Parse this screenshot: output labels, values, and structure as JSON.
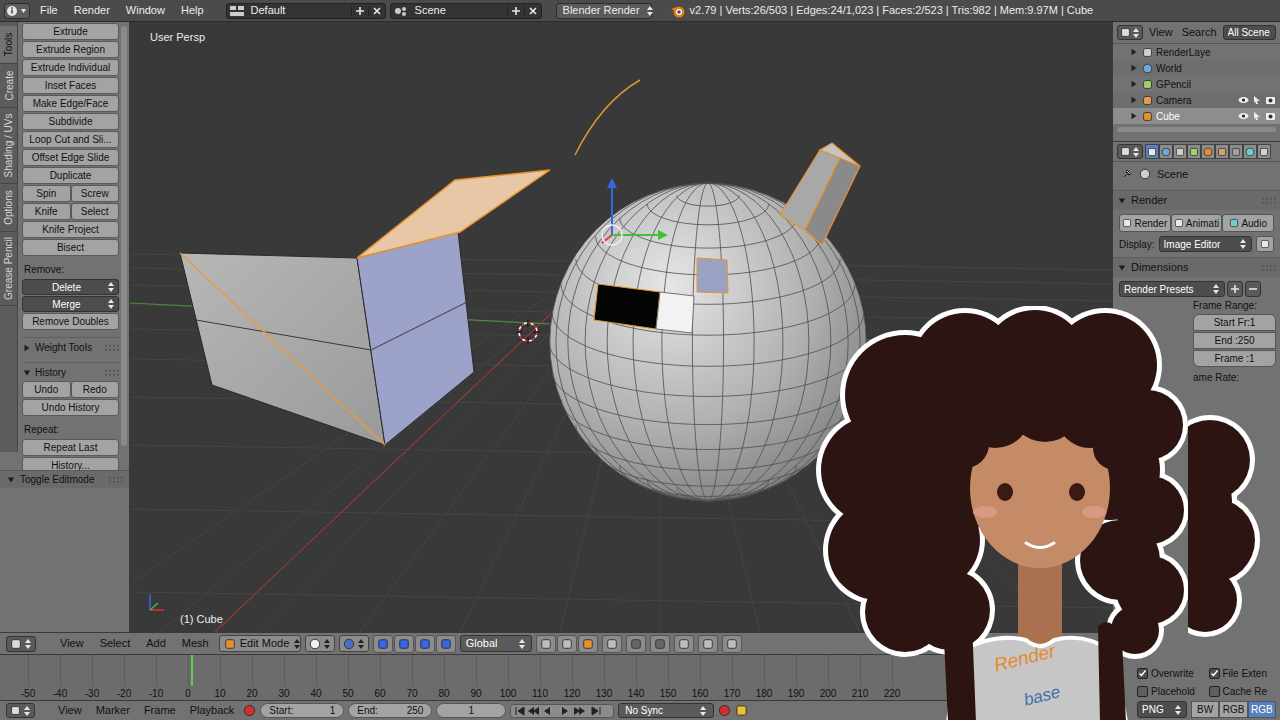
{
  "info_header": {
    "menus": [
      "File",
      "Render",
      "Window",
      "Help"
    ],
    "layout": "Default",
    "scene": "Scene",
    "engine": "Blender Render",
    "stats": "v2.79 | Verts:26/503 | Edges:24/1,023 | Faces:2/523 | Tris:982 | Mem:9.97M | Cube"
  },
  "tool_shelf": {
    "tabs": [
      {
        "label": "Tools",
        "selected": true
      },
      {
        "label": "Create",
        "selected": false
      },
      {
        "label": "Shading / UVs",
        "selected": false
      },
      {
        "label": "Options",
        "selected": false
      },
      {
        "label": "Grease Pencil",
        "selected": false
      }
    ],
    "rows": [
      {
        "kind": "button",
        "items": [
          "Extrude"
        ]
      },
      {
        "kind": "button",
        "items": [
          "Extrude Region"
        ]
      },
      {
        "kind": "button",
        "items": [
          "Extrude Individual"
        ]
      },
      {
        "kind": "button",
        "items": [
          "Inset Faces"
        ]
      },
      {
        "kind": "button",
        "items": [
          "Make Edge/Face"
        ]
      },
      {
        "kind": "button",
        "items": [
          "Subdivide"
        ]
      },
      {
        "kind": "button",
        "items": [
          "Loop Cut and Sli..."
        ]
      },
      {
        "kind": "button",
        "items": [
          "Offset Edge Slide"
        ]
      },
      {
        "kind": "button",
        "items": [
          "Duplicate"
        ]
      },
      {
        "kind": "button",
        "items": [
          "Spin",
          "Screw"
        ]
      },
      {
        "kind": "button",
        "items": [
          "Knife",
          "Select"
        ]
      },
      {
        "kind": "button",
        "items": [
          "Knife Project"
        ]
      },
      {
        "kind": "button",
        "items": [
          "Bisect"
        ]
      },
      {
        "kind": "label",
        "items": [
          "Remove:"
        ]
      },
      {
        "kind": "dropdown",
        "items": [
          "Delete"
        ]
      },
      {
        "kind": "dropdown",
        "items": [
          "Merge"
        ]
      },
      {
        "kind": "button",
        "items": [
          "Remove Doubles"
        ]
      },
      {
        "kind": "panel",
        "items": [
          "Weight Tools"
        ],
        "expanded": false
      },
      {
        "kind": "panel",
        "items": [
          "History"
        ],
        "expanded": true
      },
      {
        "kind": "button",
        "items": [
          "Undo",
          "Redo"
        ]
      },
      {
        "kind": "button",
        "items": [
          "Undo History"
        ]
      },
      {
        "kind": "label",
        "items": [
          "Repeat:"
        ]
      },
      {
        "kind": "button",
        "items": [
          "Repeat Last"
        ]
      },
      {
        "kind": "button",
        "items": [
          "History..."
        ]
      }
    ],
    "operator_panel": {
      "title": "Toggle Editmode",
      "expanded": true
    }
  },
  "viewport": {
    "view_name": "User Persp",
    "object_info": "(1) Cube"
  },
  "view3d_header": {
    "menus": [
      "View",
      "Select",
      "Add",
      "Mesh"
    ],
    "mode": "Edit Mode",
    "orientation": "Global"
  },
  "timeline": {
    "ticks": [
      "-50",
      "-40",
      "-30",
      "-20",
      "-10",
      "0",
      "10",
      "20",
      "30",
      "40",
      "50",
      "60",
      "70",
      "80",
      "90",
      "100",
      "110",
      "120",
      "130",
      "140",
      "150",
      "160",
      "170",
      "180",
      "190",
      "200",
      "210",
      "220"
    ]
  },
  "timeline_header": {
    "menus": [
      "View",
      "Marker",
      "Frame",
      "Playback"
    ],
    "start_label": "Start:",
    "start": "1",
    "end_label": "End:",
    "end": "250",
    "current": "1",
    "sync": "No Sync"
  },
  "outliner": {
    "menus": [
      "View",
      "Search"
    ],
    "filter": "All Scene",
    "items": [
      {
        "label": "RenderLaye",
        "selected": false,
        "controls": false
      },
      {
        "label": "World",
        "selected": false,
        "controls": false
      },
      {
        "label": "GPencil",
        "selected": false,
        "controls": false
      },
      {
        "label": "Camera",
        "selected": false,
        "controls": true
      },
      {
        "label": "Cube",
        "selected": true,
        "controls": true
      }
    ]
  },
  "properties": {
    "breadcrumb": "Scene",
    "render_panel": {
      "title": "Render",
      "expanded": true,
      "buttons": [
        "Render",
        "Animati",
        "Audio"
      ],
      "display_label": "Display:",
      "display_value": "Image Editor"
    },
    "dimensions_panel": {
      "title": "Dimensions",
      "expanded": true,
      "presets": "Render Presets",
      "frame_range_label": "Frame Range:",
      "fields": [
        "Start Fr:1",
        "End :250",
        "Frame :1"
      ],
      "frame_rate_label": "ame Rate:"
    },
    "output": {
      "checkboxes": [
        {
          "label": "Overwrite",
          "checked": true
        },
        {
          "label": "File Exten",
          "checked": true
        },
        {
          "label": "Placehold",
          "checked": false
        },
        {
          "label": "Cache Re",
          "checked": false
        }
      ],
      "format": "PNG",
      "color_modes": [
        {
          "label": "BW",
          "selected": false
        },
        {
          "label": "RGB",
          "selected": false
        },
        {
          "label": "RGB",
          "selected": true
        }
      ]
    }
  },
  "avatar": {
    "logo_lines": [
      "Render",
      "base"
    ]
  }
}
